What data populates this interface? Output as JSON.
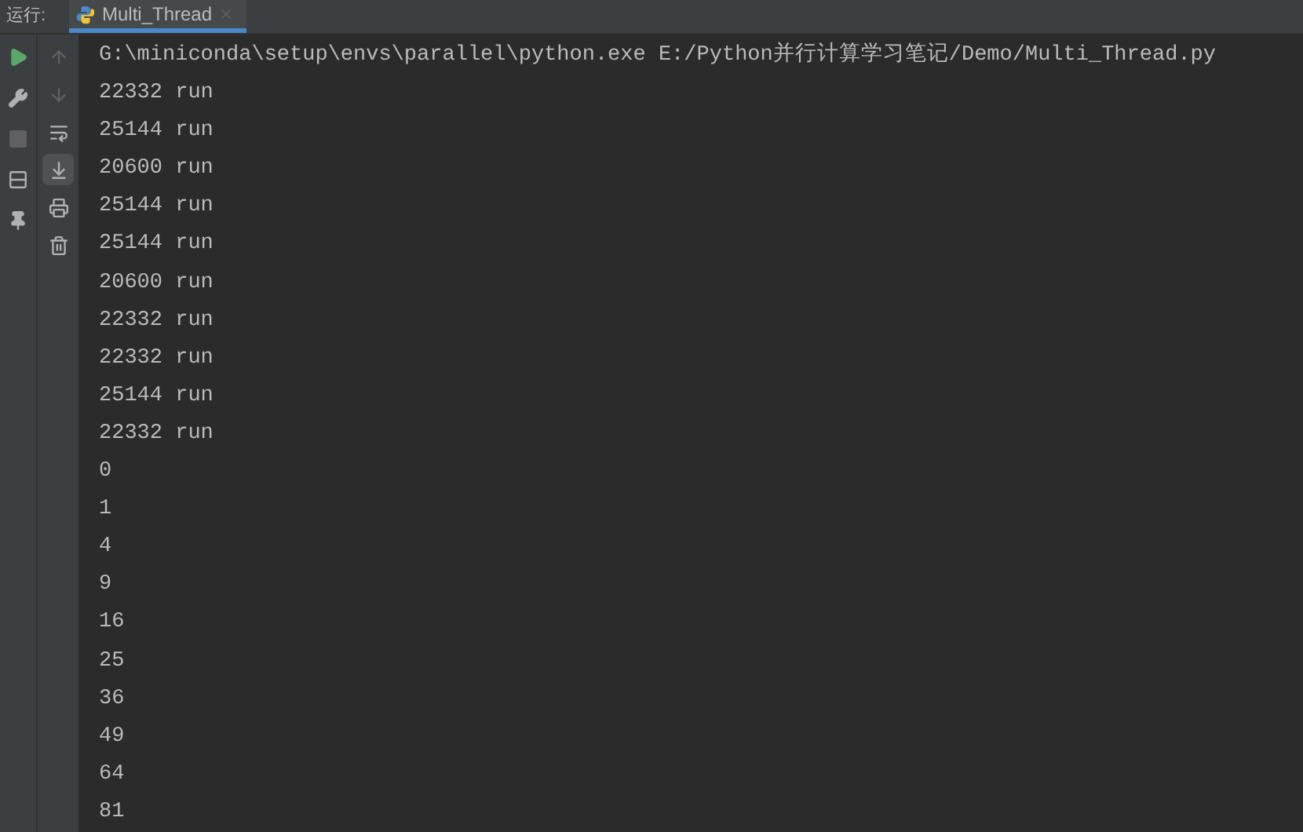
{
  "run_panel": {
    "label": "运行:",
    "tabs": [
      {
        "label": "Multi_Thread",
        "selected": true
      }
    ]
  },
  "left_toolbar": [
    {
      "kind": "run",
      "disabled": false
    },
    {
      "kind": "settings",
      "disabled": false
    },
    {
      "kind": "stop",
      "disabled": true
    },
    {
      "kind": "layout",
      "disabled": false
    },
    {
      "kind": "pin",
      "disabled": false
    }
  ],
  "console_toolbar": [
    {
      "kind": "up",
      "disabled": true,
      "selected": false
    },
    {
      "kind": "down",
      "disabled": true,
      "selected": false
    },
    {
      "kind": "wrap",
      "disabled": false,
      "selected": false
    },
    {
      "kind": "scroll-end",
      "disabled": false,
      "selected": true
    },
    {
      "kind": "print",
      "disabled": false,
      "selected": false
    },
    {
      "kind": "delete",
      "disabled": false,
      "selected": false
    }
  ],
  "console_lines": [
    "G:\\miniconda\\setup\\envs\\parallel\\python.exe E:/Python并行计算学习笔记/Demo/Multi_Thread.py",
    "22332 run",
    "25144 run",
    "20600 run",
    "25144 run",
    "25144 run",
    "20600 run",
    "22332 run",
    "22332 run",
    "25144 run",
    "22332 run",
    "0",
    "1",
    "4",
    "9",
    "16",
    "25",
    "36",
    "49",
    "64",
    "81"
  ]
}
